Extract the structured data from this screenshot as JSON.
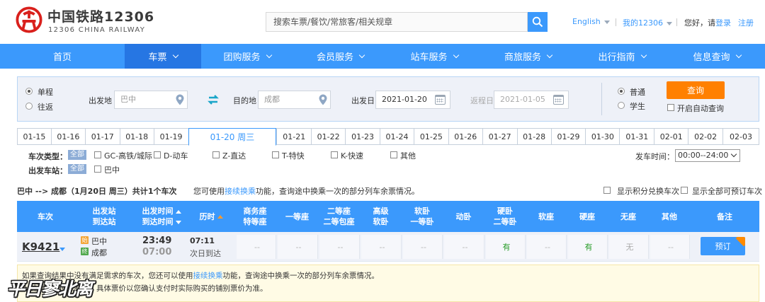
{
  "header": {
    "logo_cn": "中国铁路12306",
    "logo_en": "12306 CHINA RAILWAY",
    "search_placeholder": "搜索车票/餐饮/常旅客/相关规章",
    "lang_label": "English",
    "my_label": "我的12306",
    "greeting": "您好，请",
    "login_label": "登录",
    "register_label": "注册"
  },
  "nav": {
    "items": [
      {
        "label": "首页",
        "caret": false
      },
      {
        "label": "车票",
        "caret": true
      },
      {
        "label": "团购服务",
        "caret": true
      },
      {
        "label": "会员服务",
        "caret": true
      },
      {
        "label": "站车服务",
        "caret": true
      },
      {
        "label": "商旅服务",
        "caret": true
      },
      {
        "label": "出行指南",
        "caret": true
      },
      {
        "label": "信息查询",
        "caret": true
      }
    ],
    "active_index": 1
  },
  "query": {
    "trip_oneway": "单程",
    "trip_round": "往返",
    "from_label": "出发地",
    "from_value": "巴中",
    "to_label": "目的地",
    "to_value": "成都",
    "depart_label": "出发日",
    "depart_value": "2021-01-20",
    "return_label": "返程日",
    "return_value": "2021-01-05",
    "ticket_normal": "普通",
    "ticket_student": "学生",
    "query_button": "查询",
    "auto_query_label": "开启自动查询"
  },
  "dates": {
    "tabs": [
      "01-15",
      "01-16",
      "01-17",
      "01-18",
      "01-19",
      "01-20 周三",
      "01-21",
      "01-22",
      "01-23",
      "01-24",
      "01-25",
      "01-26",
      "01-27",
      "01-28",
      "01-29",
      "01-30",
      "01-31",
      "02-01",
      "02-02",
      "02-03"
    ],
    "active_index": 5
  },
  "filters": {
    "type_label": "车次类型：",
    "all_label": "全部",
    "types": [
      "GC-高铁/城际",
      "D-动车",
      "Z-直达",
      "T-特快",
      "K-快速",
      "其他"
    ],
    "station_label": "出发车站：",
    "stations": [
      "巴中"
    ],
    "time_label": "发车时间：",
    "time_value": "00:00--24:00"
  },
  "summary": {
    "route": "巴中 --> 成都（1月20日 周三）共计",
    "count": "1",
    "suffix": "个车次",
    "hint_pre": "您可使用",
    "hint_link": "接续换乘",
    "hint_post": "功能，查询途中换乘一次的部分列车余票情况。",
    "show_points": "显示积分兑换车次",
    "show_all": "显示全部可预订车次"
  },
  "table": {
    "headers": [
      {
        "l1": "车次",
        "l2": ""
      },
      {
        "l1": "出发站",
        "l2": "到达站"
      },
      {
        "l1": "出发时间",
        "l2": "到达时间"
      },
      {
        "l1": "历时",
        "l2": ""
      },
      {
        "l1": "商务座",
        "l2": "特等座"
      },
      {
        "l1": "一等座",
        "l2": ""
      },
      {
        "l1": "二等座",
        "l2": "二等包座"
      },
      {
        "l1": "高级",
        "l2": "软卧"
      },
      {
        "l1": "软卧",
        "l2": "一等卧"
      },
      {
        "l1": "动卧",
        "l2": ""
      },
      {
        "l1": "硬卧",
        "l2": "二等卧"
      },
      {
        "l1": "软座",
        "l2": ""
      },
      {
        "l1": "硬座",
        "l2": ""
      },
      {
        "l1": "无座",
        "l2": ""
      },
      {
        "l1": "其他",
        "l2": ""
      },
      {
        "l1": "备注",
        "l2": ""
      }
    ],
    "row": {
      "train_no": "K9421",
      "from_badge": "始",
      "from_station": "巴中",
      "to_badge": "终",
      "to_station": "成都",
      "depart_time": "23:49",
      "arrive_time": "07:00",
      "duration": "07:11",
      "arrive_day": "次日到达",
      "seats": [
        "--",
        "--",
        "--",
        "--",
        "--",
        "--",
        "有",
        "--",
        "有",
        "无",
        "--"
      ],
      "book_label": "预订"
    }
  },
  "notice": {
    "line1_pre": "如果查询结果中没有满足需求的车次，您还可以使用",
    "line1_link": "接续换乘",
    "line1_post": "功能，查询途中换乘一次的部分列车余票情况。",
    "line2": "上铺票价，供您参考。具体票价以您确认支付时实际购买的铺别票价为准。"
  },
  "watermark": "平日寥北离",
  "colors": {
    "brand_blue": "#3b99fc",
    "nav_active": "#2676e3",
    "query_orange": "#ff8000",
    "available_green": "#2a9d2a",
    "logo_red": "#d9201c"
  }
}
